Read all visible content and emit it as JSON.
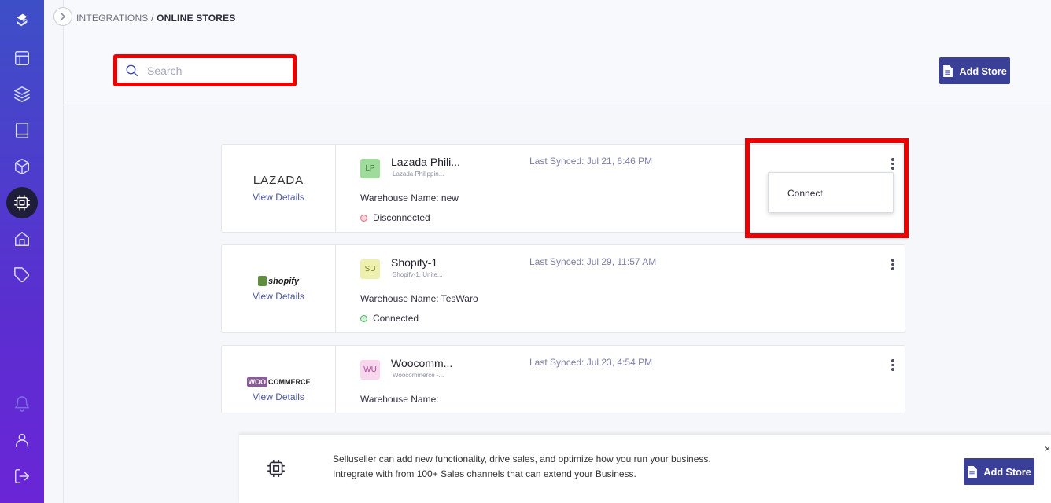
{
  "breadcrumb": {
    "parent": "INTEGRATIONS",
    "separator": " / ",
    "current": "ONLINE STORES"
  },
  "search": {
    "placeholder": "Search",
    "value": ""
  },
  "header": {
    "add_store_label": "Add Store"
  },
  "sidebar": {
    "items": [
      {
        "icon": "logo-icon"
      },
      {
        "icon": "layout-icon"
      },
      {
        "icon": "layers-icon"
      },
      {
        "icon": "book-icon"
      },
      {
        "icon": "box-icon"
      },
      {
        "icon": "chip-icon",
        "active": true
      },
      {
        "icon": "warehouse-icon"
      },
      {
        "icon": "tag-icon"
      },
      {
        "icon": "bell-icon"
      },
      {
        "icon": "user-icon"
      },
      {
        "icon": "logout-icon"
      }
    ]
  },
  "stores": [
    {
      "platform": "LAZADA",
      "view_details": "View Details",
      "initials": "LP",
      "badge_bg": "#9fdc9b",
      "badge_fg": "#3d7a3a",
      "name": "Lazada Phili...",
      "subtitle": "Lazada Philippin...",
      "last_synced": "Last Synced: Jul 21, 6:46 PM",
      "warehouse": "Warehouse Name: new",
      "status": "Disconnected",
      "status_color": "red"
    },
    {
      "platform": "shopify",
      "view_details": "View Details",
      "initials": "SU",
      "badge_bg": "#eef0b0",
      "badge_fg": "#7b7f2a",
      "name": "Shopify-1",
      "subtitle": "Shopify-1, Unite...",
      "last_synced": "Last Synced: Jul 29, 11:57 AM",
      "warehouse": "Warehouse Name: TesWaro",
      "status": "Connected",
      "status_color": "green"
    },
    {
      "platform_box": "WOO",
      "platform": "COMMERCE",
      "view_details": "View Details",
      "initials": "WU",
      "badge_bg": "#f8d6ee",
      "badge_fg": "#b0489a",
      "name": "Woocomm...",
      "subtitle": "Woocommerce -...",
      "last_synced": "Last Synced: Jul 23, 4:54 PM",
      "warehouse": "Warehouse Name:",
      "status": "",
      "status_color": ""
    }
  ],
  "context_menu": {
    "items": [
      "Connect"
    ]
  },
  "banner": {
    "line1": "Selluseller can add new functionality, drive sales, and optimize how you run your business.",
    "line2": "Intregrate with from 100+ Sales channels that can extend your Business.",
    "button_label": "Add Store",
    "close": "×"
  },
  "colors": {
    "accent": "#3a3f98",
    "highlight": "#ee0000",
    "sidebar_top": "#3d4fc7",
    "sidebar_bottom": "#6a25d6"
  }
}
